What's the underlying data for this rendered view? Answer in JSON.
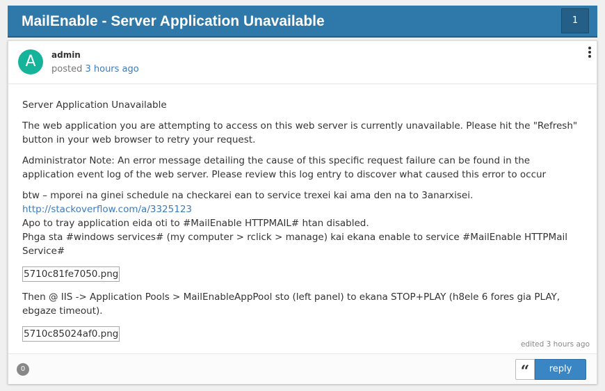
{
  "topic": {
    "title": "MailEnable - Server Application Unavailable",
    "post_count": "1"
  },
  "post": {
    "avatar_letter": "A",
    "author": "admin",
    "posted_prefix": "posted",
    "posted_time": "3 hours ago",
    "body": {
      "p1": "Server Application Unavailable",
      "p2": "The web application you are attempting to access on this web server is currently unavailable. Please hit the \"Refresh\" button in your web browser to retry your request.",
      "p3": "Administrator Note: An error message detailing the cause of this specific request failure can be found in the application event log of the web server. Please review this log entry to discover what caused this error to occur",
      "p4_line1": "btw – mporei na ginei schedule na checkarei ean to service trexei kai ama den na to 3anarxisei.",
      "p4_link": "http://stackoverflow.com/a/3325123",
      "p4_line3": "Apo to tray application eida oti to #MailEnable HTTPMAIL# htan disabled.",
      "p4_line4": "Phga sta #windows services# (my computer > rclick > manage) kai ekana enable to service #MailEnable HTTPMail Service#",
      "attachment1": "5710c81fe7050.png",
      "p5": "Then @ IIS -> Application Pools > MailEnableAppPool sto (left panel) to ekana STOP+PLAY (h8ele 6 fores gia PLAY, ebgaze timeout).",
      "attachment2": "5710c85024af0.png"
    },
    "edited": "edited 3 hours ago",
    "votes": "0",
    "quote_icon": "quote-icon",
    "quote_glyph": "“",
    "reply_label": "reply"
  },
  "colors": {
    "header_bg": "#2f78aa",
    "avatar_bg": "#14b39a",
    "link": "#3a7bbf",
    "reply_bg": "#3a86c4"
  }
}
